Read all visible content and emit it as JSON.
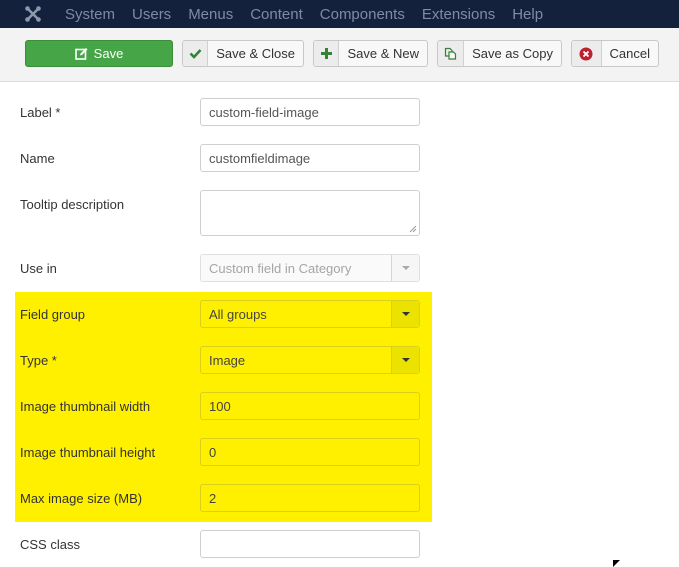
{
  "topnav": {
    "logo": "joomla-icon",
    "items": [
      "System",
      "Users",
      "Menus",
      "Content",
      "Components",
      "Extensions",
      "Help"
    ]
  },
  "toolbar": {
    "save": {
      "label": "Save",
      "icon": "edit-icon"
    },
    "save_close": {
      "label": "Save & Close",
      "icon": "checkmark-icon"
    },
    "save_new": {
      "label": "Save & New",
      "icon": "plus-icon"
    },
    "save_copy": {
      "label": "Save as Copy",
      "icon": "copy-icon"
    },
    "cancel": {
      "label": "Cancel",
      "icon": "cancel-circle-icon"
    }
  },
  "form": {
    "label": {
      "label": "Label *",
      "value": "custom-field-image"
    },
    "name": {
      "label": "Name",
      "value": "customfieldimage"
    },
    "tooltip": {
      "label": "Tooltip description",
      "value": ""
    },
    "use_in": {
      "label": "Use in",
      "value": "Custom field in Category",
      "disabled": true
    },
    "field_group": {
      "label": "Field group",
      "value": "All groups"
    },
    "type": {
      "label": "Type *",
      "value": "Image"
    },
    "thumb_width": {
      "label": "Image thumbnail width",
      "value": "100"
    },
    "thumb_height": {
      "label": "Image thumbnail height",
      "value": "0"
    },
    "max_size": {
      "label": "Max image size (MB)",
      "value": "2"
    },
    "css_class": {
      "label": "CSS class",
      "value": ""
    }
  },
  "colors": {
    "nav_bg": "#14213d",
    "save_green": "#46a546",
    "highlight_yellow": "#fff000",
    "cancel_red": "#bd2130",
    "plus_green": "#378137"
  }
}
